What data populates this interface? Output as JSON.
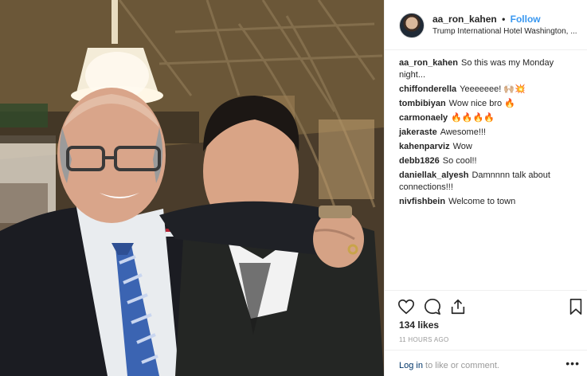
{
  "post": {
    "username": "aa_ron_kahen",
    "follow_label": "Follow",
    "location": "Trump International Hotel Washington, ..."
  },
  "comments": [
    {
      "user": "aa_ron_kahen",
      "text": "So this was my Monday night..."
    },
    {
      "user": "chiffonderella",
      "text": "Yeeeeeee! 🙌🏼💥"
    },
    {
      "user": "tombibiyan",
      "text": "Wow nice bro 🔥"
    },
    {
      "user": "carmonaely",
      "text": "🔥🔥🔥🔥"
    },
    {
      "user": "jakeraste",
      "text": "Awesome!!!"
    },
    {
      "user": "kahenparviz",
      "text": "Wow"
    },
    {
      "user": "debb1826",
      "text": "So cool!!"
    },
    {
      "user": "daniellak_alyesh",
      "text": "Damnnnn talk about connections!!!"
    },
    {
      "user": "nivfishbein",
      "text": "Welcome to town"
    }
  ],
  "stats": {
    "likes": "134 likes",
    "time": "11 HOURS AGO"
  },
  "comment_bar": {
    "login_label": "Log in",
    "rest_text": " to like or comment.",
    "more_label": "•••"
  },
  "icons": {
    "like": "heart-icon",
    "comment": "comment-icon",
    "share": "share-icon",
    "save": "bookmark-icon"
  }
}
